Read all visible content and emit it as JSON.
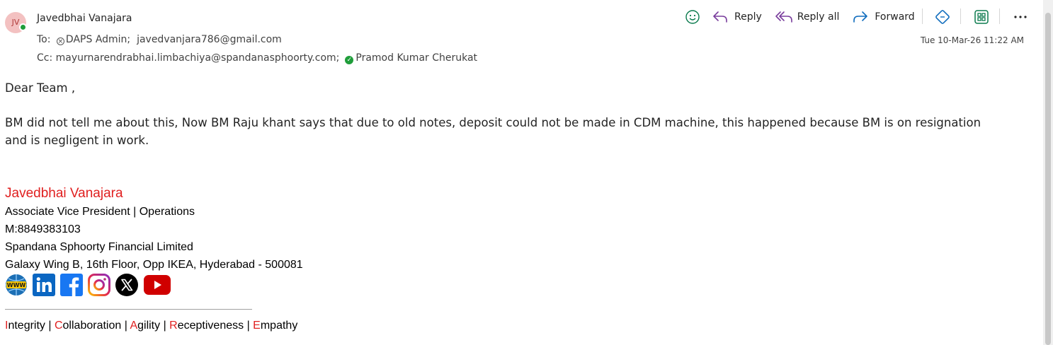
{
  "sender": {
    "initials": "JV",
    "name": "Javedbhai Vanajara"
  },
  "recipients": {
    "to_label": "To:",
    "to": [
      "DAPS Admin;",
      "javedvanjara786@gmail.com"
    ],
    "cc_label": "Cc:",
    "cc": [
      "mayurnarendrabhai.limbachiya@spandanasphoorty.com;",
      "Pramod Kumar Cherukat"
    ]
  },
  "toolbar": {
    "reply_label": "Reply",
    "reply_all_label": "Reply all",
    "forward_label": "Forward"
  },
  "timestamp": "Tue 10-Mar-26 11:22 AM",
  "message": {
    "greeting": "Dear Team  ,",
    "paragraph_line1": "BM did not tell me about this, Now BM Raju khant says that due to old notes, deposit could not be made in CDM machine, this happened because BM is on resignation",
    "paragraph_line2": "and is negligent in work."
  },
  "signature": {
    "name": "Javedbhai Vanajara",
    "title": "Associate Vice President | Operations",
    "mobile": "M:8849383103",
    "company": "Spandana Sphoorty Financial Limited",
    "address": "Galaxy Wing B, 16th Floor, Opp IKEA, Hyderabad - 500081",
    "social_icons": [
      "www-icon",
      "linkedin-icon",
      "facebook-icon",
      "instagram-icon",
      "x-icon",
      "youtube-icon"
    ]
  },
  "values_line": [
    {
      "first": "I",
      "rest": "ntegrity"
    },
    {
      "first": "C",
      "rest": "ollaboration"
    },
    {
      "first": "A",
      "rest": "gility"
    },
    {
      "first": "R",
      "rest": "eceptiveness"
    },
    {
      "first": "E",
      "rest": "mpathy"
    }
  ],
  "values_separator": " | ",
  "colors": {
    "accent": "#0f6cbd",
    "signature_red": "#e02020",
    "presence_green": "#1f9d3a",
    "reply_purple": "#7a3e9d"
  }
}
